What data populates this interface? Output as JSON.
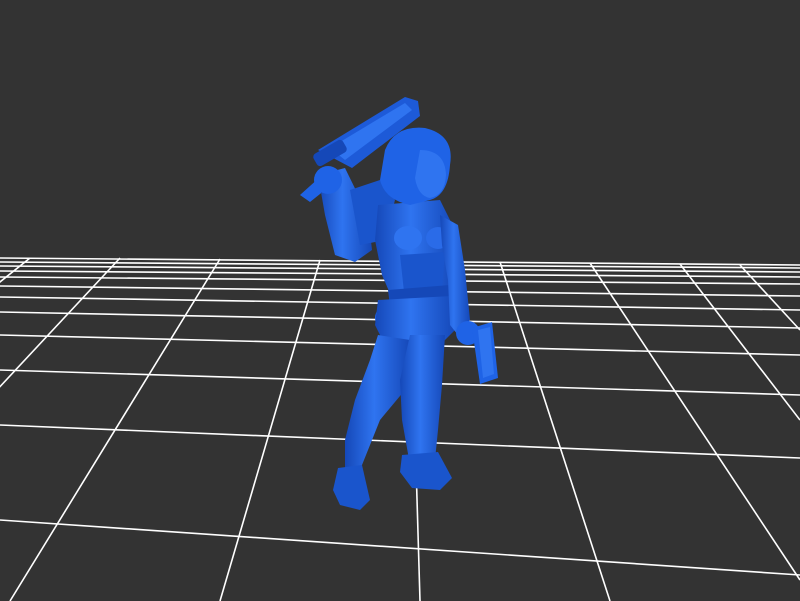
{
  "viewer": {
    "background_color": "#333333",
    "grid_color": "#ffffff",
    "model_color": "#1f63e6",
    "model_shade_color": "#1548b8",
    "model_highlight_color": "#4d8cff",
    "grid_visible": true,
    "model": "female-warrior-figure-with-sword-and-shield"
  }
}
